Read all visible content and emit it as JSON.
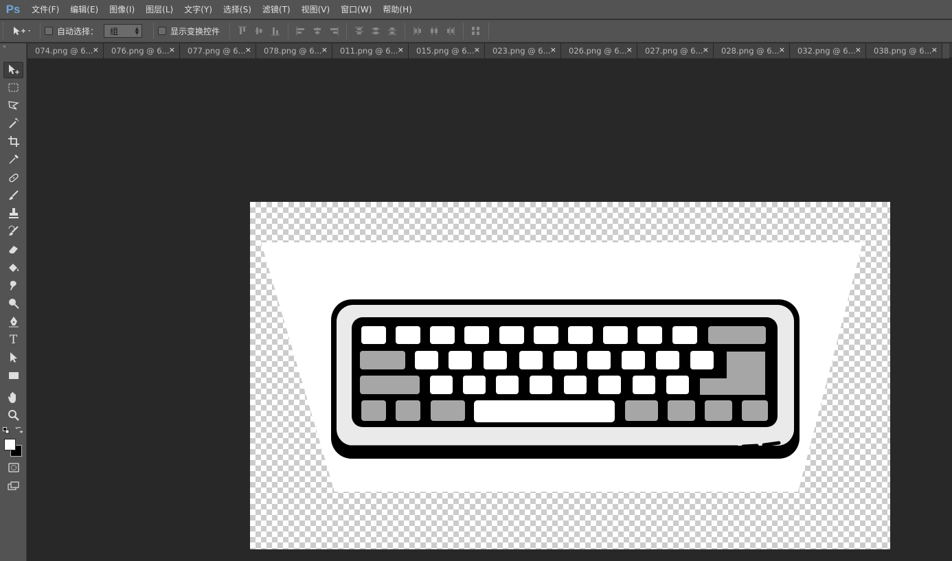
{
  "app": {
    "logo": "Ps"
  },
  "menu": [
    {
      "label": "文件(F)"
    },
    {
      "label": "编辑(E)"
    },
    {
      "label": "图像(I)"
    },
    {
      "label": "图层(L)"
    },
    {
      "label": "文字(Y)"
    },
    {
      "label": "选择(S)"
    },
    {
      "label": "滤镜(T)"
    },
    {
      "label": "视图(V)"
    },
    {
      "label": "窗口(W)"
    },
    {
      "label": "帮助(H)"
    }
  ],
  "options": {
    "auto_select_label": "自动选择：",
    "auto_select_value": "组",
    "show_transform_label": "显示变换控件"
  },
  "tabs": [
    {
      "label": "074.png @ 6..."
    },
    {
      "label": "076.png @ 6..."
    },
    {
      "label": "077.png @ 6..."
    },
    {
      "label": "078.png @ 6..."
    },
    {
      "label": "011.png @ 6..."
    },
    {
      "label": "015.png @ 6..."
    },
    {
      "label": "023.png @ 6..."
    },
    {
      "label": "026.png @ 6..."
    },
    {
      "label": "027.png @ 6..."
    },
    {
      "label": "028.png @ 6..."
    },
    {
      "label": "032.png @ 6..."
    },
    {
      "label": "038.png @ 6..."
    }
  ],
  "tab_close_glyph": "×",
  "tools": [
    {
      "name": "move-tool-icon"
    },
    {
      "name": "marquee-tool-icon"
    },
    {
      "name": "lasso-tool-icon"
    },
    {
      "name": "magic-wand-tool-icon"
    },
    {
      "name": "crop-tool-icon"
    },
    {
      "name": "eyedropper-tool-icon"
    },
    {
      "name": "healing-brush-tool-icon"
    },
    {
      "name": "brush-tool-icon"
    },
    {
      "name": "clone-stamp-tool-icon"
    },
    {
      "name": "history-brush-tool-icon"
    },
    {
      "name": "eraser-tool-icon"
    },
    {
      "name": "paint-bucket-tool-icon"
    },
    {
      "name": "smudge-tool-icon"
    },
    {
      "name": "dodge-tool-icon"
    },
    {
      "name": "pen-tool-icon"
    },
    {
      "name": "type-tool-icon"
    },
    {
      "name": "path-selection-tool-icon"
    },
    {
      "name": "rectangle-tool-icon"
    },
    {
      "name": "hand-tool-icon"
    },
    {
      "name": "zoom-tool-icon"
    }
  ],
  "type_tool_glyph": "T",
  "colors": {
    "foreground": "#ffffff",
    "background": "#000000",
    "accent": "#6fa6d8"
  }
}
